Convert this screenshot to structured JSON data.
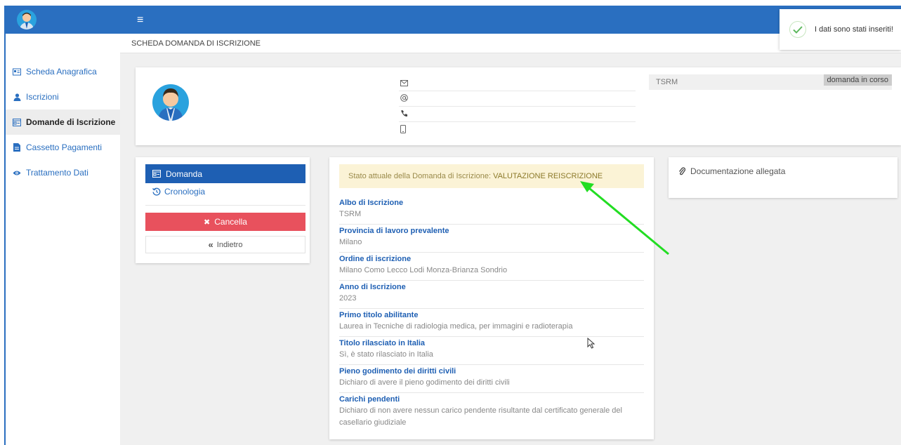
{
  "sidebar": {
    "items": [
      {
        "label": "Scheda Anagrafica",
        "icon": "id-card-icon"
      },
      {
        "label": "Iscrizioni",
        "icon": "user-icon"
      },
      {
        "label": "Domande di Iscrizione",
        "icon": "form-icon",
        "active": true
      },
      {
        "label": "Cassetto Pagamenti",
        "icon": "document-icon"
      },
      {
        "label": "Trattamento Dati",
        "icon": "eye-icon"
      }
    ]
  },
  "topbar": {
    "menu_icon": "≡"
  },
  "breadcrumb": {
    "title": "SCHEDA DOMANDA DI ISCRIZIONE"
  },
  "profile": {
    "albo": "TSRM",
    "status": "domanda in corso",
    "contact_icons": [
      "envelope-icon",
      "at-icon",
      "phone-icon",
      "mobile-icon"
    ]
  },
  "menu": {
    "domanda_label": "Domanda",
    "cronologia_label": "Cronologia",
    "cancella_label": "Cancella",
    "indietro_label": "Indietro",
    "cancel_glyph": "✖",
    "back_glyph": "«"
  },
  "detail": {
    "state_prefix": "Stato attuale della Domanda di Iscrizione: ",
    "state_value": "VALUTAZIONE REISCRIZIONE",
    "fields": [
      {
        "label": "Albo di Iscrizione",
        "value": "TSRM"
      },
      {
        "label": "Provincia di lavoro prevalente",
        "value": "Milano"
      },
      {
        "label": "Ordine di iscrizione",
        "value": "Milano Como Lecco Lodi Monza-Brianza Sondrio"
      },
      {
        "label": "Anno di Iscrizione",
        "value": "2023"
      },
      {
        "label": "Primo titolo abilitante",
        "value": "Laurea in Tecniche di radiologia medica, per immagini e radioterapia"
      },
      {
        "label": "Titolo rilasciato in Italia",
        "value": "Sì, è stato rilasciato in Italia"
      },
      {
        "label": "Pieno godimento dei diritti civili",
        "value": "Dichiaro di avere il pieno godimento dei diritti civili"
      },
      {
        "label": "Carichi pendenti",
        "value": "Dichiaro di non avere nessun carico pendente risultante dal certificato generale del casellario giudiziale"
      }
    ]
  },
  "docs": {
    "title": "Documentazione allegata"
  },
  "toast": {
    "message": "I dati sono stati inseriti!"
  },
  "colors": {
    "primary": "#2a6fc0",
    "danger": "#e8515d",
    "banner": "#fbf3d6",
    "arrow": "#22dd22"
  }
}
